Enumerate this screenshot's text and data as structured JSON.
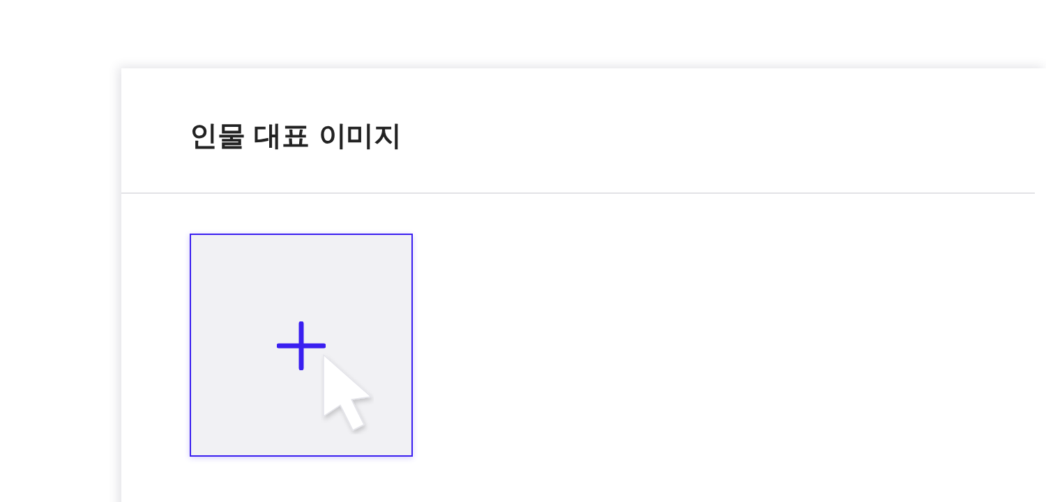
{
  "section": {
    "title": "인물 대표 이미지"
  },
  "upload_tile": {
    "hovered": true
  }
}
